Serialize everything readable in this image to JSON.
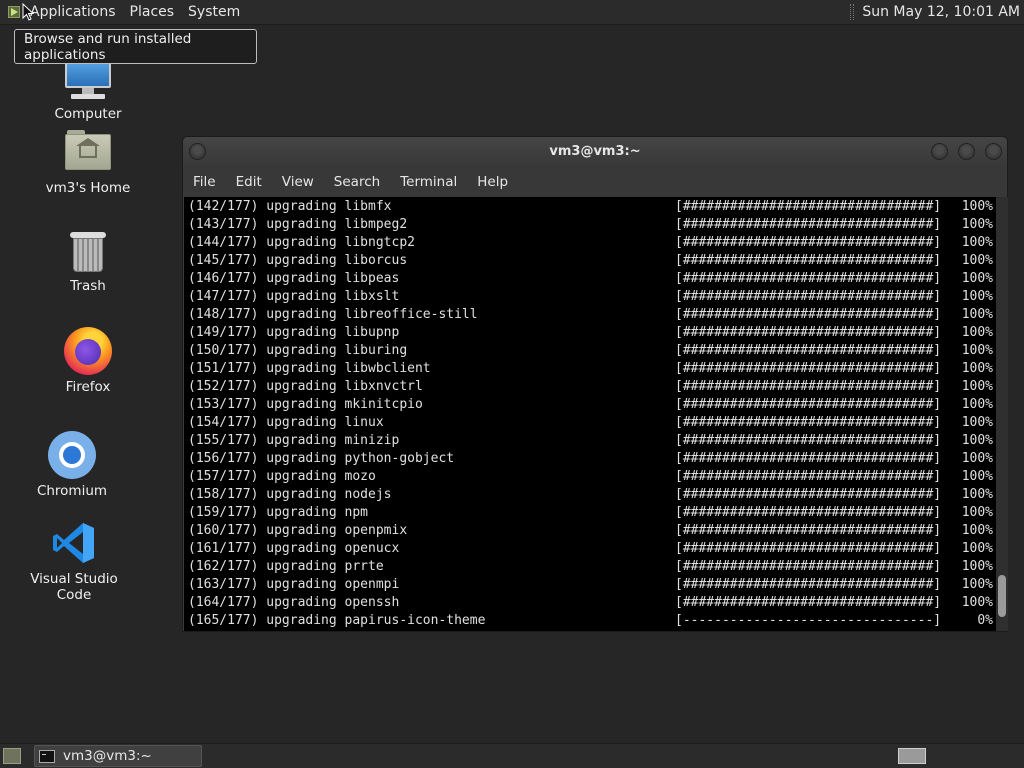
{
  "top_panel": {
    "menus": [
      "Applications",
      "Places",
      "System"
    ],
    "clock": "Sun May 12, 10:01 AM"
  },
  "tooltip": "Browse and run installed applications",
  "desktop_icons": {
    "computer": "Computer",
    "home": "vm3's Home",
    "trash": "Trash",
    "firefox": "Firefox",
    "chromium": "Chromium",
    "vscode": "Visual Studio Code"
  },
  "terminal": {
    "title": "vm3@vm3:~",
    "menu": [
      "File",
      "Edit",
      "View",
      "Search",
      "Terminal",
      "Help"
    ],
    "lines": [
      {
        "text": "(142/177) upgrading libmfx",
        "bar": "[################################]",
        "pct": "100%"
      },
      {
        "text": "(143/177) upgrading libmpeg2",
        "bar": "[################################]",
        "pct": "100%"
      },
      {
        "text": "(144/177) upgrading libngtcp2",
        "bar": "[################################]",
        "pct": "100%"
      },
      {
        "text": "(145/177) upgrading liborcus",
        "bar": "[################################]",
        "pct": "100%"
      },
      {
        "text": "(146/177) upgrading libpeas",
        "bar": "[################################]",
        "pct": "100%"
      },
      {
        "text": "(147/177) upgrading libxslt",
        "bar": "[################################]",
        "pct": "100%"
      },
      {
        "text": "(148/177) upgrading libreoffice-still",
        "bar": "[################################]",
        "pct": "100%"
      },
      {
        "text": "(149/177) upgrading libupnp",
        "bar": "[################################]",
        "pct": "100%"
      },
      {
        "text": "(150/177) upgrading liburing",
        "bar": "[################################]",
        "pct": "100%"
      },
      {
        "text": "(151/177) upgrading libwbclient",
        "bar": "[################################]",
        "pct": "100%"
      },
      {
        "text": "(152/177) upgrading libxnvctrl",
        "bar": "[################################]",
        "pct": "100%"
      },
      {
        "text": "(153/177) upgrading mkinitcpio",
        "bar": "[################################]",
        "pct": "100%"
      },
      {
        "text": "(154/177) upgrading linux",
        "bar": "[################################]",
        "pct": "100%"
      },
      {
        "text": "(155/177) upgrading minizip",
        "bar": "[################################]",
        "pct": "100%"
      },
      {
        "text": "(156/177) upgrading python-gobject",
        "bar": "[################################]",
        "pct": "100%"
      },
      {
        "text": "(157/177) upgrading mozo",
        "bar": "[################################]",
        "pct": "100%"
      },
      {
        "text": "(158/177) upgrading nodejs",
        "bar": "[################################]",
        "pct": "100%"
      },
      {
        "text": "(159/177) upgrading npm",
        "bar": "[################################]",
        "pct": "100%"
      },
      {
        "text": "(160/177) upgrading openpmix",
        "bar": "[################################]",
        "pct": "100%"
      },
      {
        "text": "(161/177) upgrading openucx",
        "bar": "[################################]",
        "pct": "100%"
      },
      {
        "text": "(162/177) upgrading prrte",
        "bar": "[################################]",
        "pct": "100%"
      },
      {
        "text": "(163/177) upgrading openmpi",
        "bar": "[################################]",
        "pct": "100%"
      },
      {
        "text": "(164/177) upgrading openssh",
        "bar": "[################################]",
        "pct": "100%"
      },
      {
        "text": "(165/177) upgrading papirus-icon-theme",
        "bar": "[--------------------------------]",
        "pct": "0%"
      }
    ]
  },
  "taskbar": {
    "window_label": "vm3@vm3:~"
  }
}
